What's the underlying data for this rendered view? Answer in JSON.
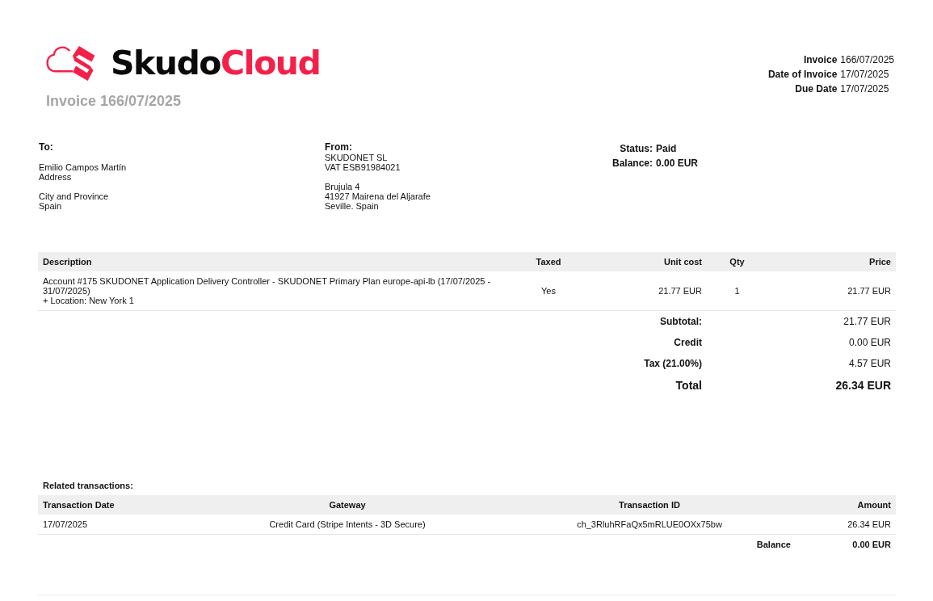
{
  "logo": {
    "text_dark": "Skudo",
    "text_accent": "Cloud"
  },
  "title": "Invoice 166/07/2025",
  "meta": [
    {
      "label": "Invoice",
      "value": "166/07/2025"
    },
    {
      "label": "Date of Invoice",
      "value": "17/07/2025"
    },
    {
      "label": "Due Date",
      "value": "17/07/2025"
    }
  ],
  "to": {
    "heading": "To:",
    "blocks": [
      [
        "Emilio Campos Martín",
        "Address"
      ],
      [
        "City and Province",
        "Spain"
      ]
    ]
  },
  "from": {
    "heading": "From:",
    "blocks": [
      [
        "SKUDONET SL",
        "VAT ESB91984021"
      ],
      [
        "Brujula 4",
        "41927 Mairena del Aljarafe",
        "Seville. Spain"
      ]
    ]
  },
  "status": [
    {
      "label": "Status:",
      "value": "Paid"
    },
    {
      "label": "Balance:",
      "value": "0.00 EUR"
    }
  ],
  "items": {
    "columns": [
      "Description",
      "Taxed",
      "Unit cost",
      "Qty",
      "Price"
    ],
    "rows": [
      {
        "description": [
          "Account #175 SKUDONET Application Delivery Controller - SKUDONET Primary Plan europe-api-lb (17/07/2025 - 31/07/2025)",
          "+ Location: New York 1"
        ],
        "taxed": "Yes",
        "unit_cost": "21.77 EUR",
        "qty": "1",
        "price": "21.77 EUR"
      }
    ],
    "totals": [
      {
        "label": "Subtotal:",
        "value": "21.77 EUR",
        "kind": "normal"
      },
      {
        "label": "Credit",
        "value": "0.00 EUR",
        "kind": "normal"
      },
      {
        "label": "Tax (21.00%)",
        "value": "4.57 EUR",
        "kind": "normal"
      },
      {
        "label": "Total",
        "value": "26.34 EUR",
        "kind": "grand"
      }
    ]
  },
  "transactions": {
    "heading": "Related transactions:",
    "columns": [
      "Transaction Date",
      "Gateway",
      "Transaction ID",
      "Amount"
    ],
    "rows": [
      {
        "date": "17/07/2025",
        "gateway": "Credit Card (Stripe Intents - 3D Secure)",
        "id": "ch_3RluhRFaQx5mRLUE0OXx75bw",
        "amount": "26.34 EUR"
      }
    ],
    "balance": {
      "label": "Balance",
      "value": "0.00 EUR"
    }
  }
}
